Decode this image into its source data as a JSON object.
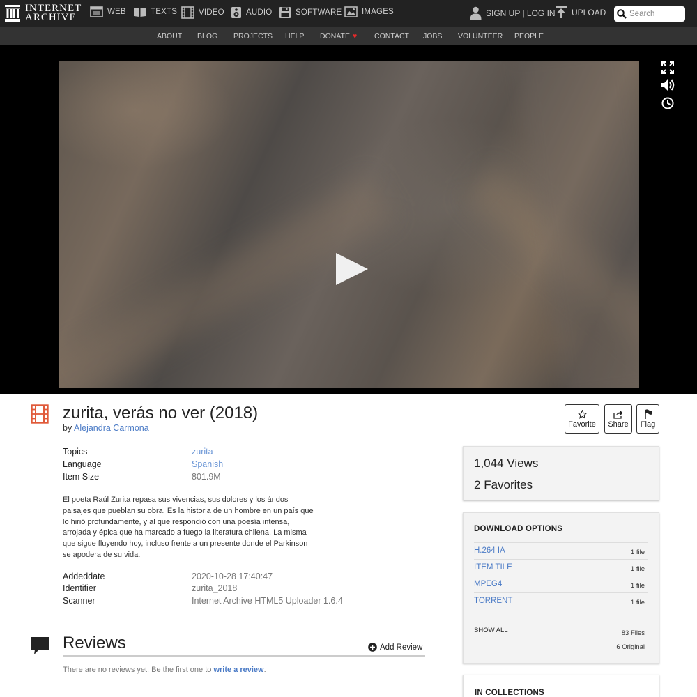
{
  "brand": {
    "line1": "INTERNET",
    "line2": "ARCHIVE"
  },
  "topnav": {
    "media": [
      {
        "id": "web",
        "label": "WEB"
      },
      {
        "id": "texts",
        "label": "TEXTS"
      },
      {
        "id": "video",
        "label": "VIDEO"
      },
      {
        "id": "audio",
        "label": "AUDIO"
      },
      {
        "id": "software",
        "label": "SOFTWARE"
      },
      {
        "id": "images",
        "label": "IMAGES"
      }
    ],
    "signup_label": "SIGN UP | LOG IN",
    "upload_label": "UPLOAD",
    "search_placeholder": "Search"
  },
  "subnav": [
    "ABOUT",
    "BLOG",
    "PROJECTS",
    "HELP",
    "DONATE",
    "CONTACT",
    "JOBS",
    "VOLUNTEER",
    "PEOPLE"
  ],
  "item": {
    "title": "zurita, verás no ver (2018)",
    "by_label": "by",
    "author": "Alejandra Carmona",
    "actions": {
      "favorite": "Favorite",
      "share": "Share",
      "flag": "Flag"
    },
    "metadata_top": [
      {
        "label": "Topics",
        "value": "zurita",
        "link": true
      },
      {
        "label": "Language",
        "value": "Spanish",
        "link": true
      },
      {
        "label": "Item Size",
        "value": "801.9M",
        "link": false
      }
    ],
    "description": "El poeta Raúl Zurita repasa sus vivencias, sus dolores y los áridos paisajes que pueblan su obra. Es la historia de un hombre en un país que lo hirió profundamente, y al que respondió con una poesía intensa, arrojada y épica que ha marcado a fuego la literatura chilena. La misma que sigue fluyendo hoy, incluso frente a un presente donde el Parkinson se apodera de su vida.",
    "metadata_bottom": [
      {
        "label": "Addeddate",
        "value": "2020-10-28 17:40:47"
      },
      {
        "label": "Identifier",
        "value": "zurita_2018"
      },
      {
        "label": "Scanner",
        "value": "Internet Archive HTML5 Uploader 1.6.4"
      }
    ]
  },
  "reviews": {
    "heading": "Reviews",
    "add_label": "Add Review",
    "empty_prefix": "There are no reviews yet. Be the first one to",
    "empty_link": "write a review",
    "empty_suffix": "."
  },
  "stats": {
    "views_count": "1,044",
    "views_label": "Views",
    "favorites_count": "2",
    "favorites_label": "Favorites"
  },
  "downloads": {
    "heading": "DOWNLOAD OPTIONS",
    "rows": [
      {
        "name": "H.264 IA",
        "count": "1 file"
      },
      {
        "name": "ITEM TILE",
        "count": "1 file"
      },
      {
        "name": "MPEG4",
        "count": "1 file"
      },
      {
        "name": "TORRENT",
        "count": "1 file"
      }
    ],
    "show_all": "SHOW ALL",
    "total_files": "83 Files",
    "original_files": "6 Original"
  },
  "collections": {
    "heading": "IN COLLECTIONS"
  },
  "colors": {
    "accent_link": "#4b7bc6",
    "nav_bg": "#222222",
    "subnav_bg": "#333333",
    "item_icon": "#e05a3a",
    "donate_heart": "#e42a2a"
  }
}
